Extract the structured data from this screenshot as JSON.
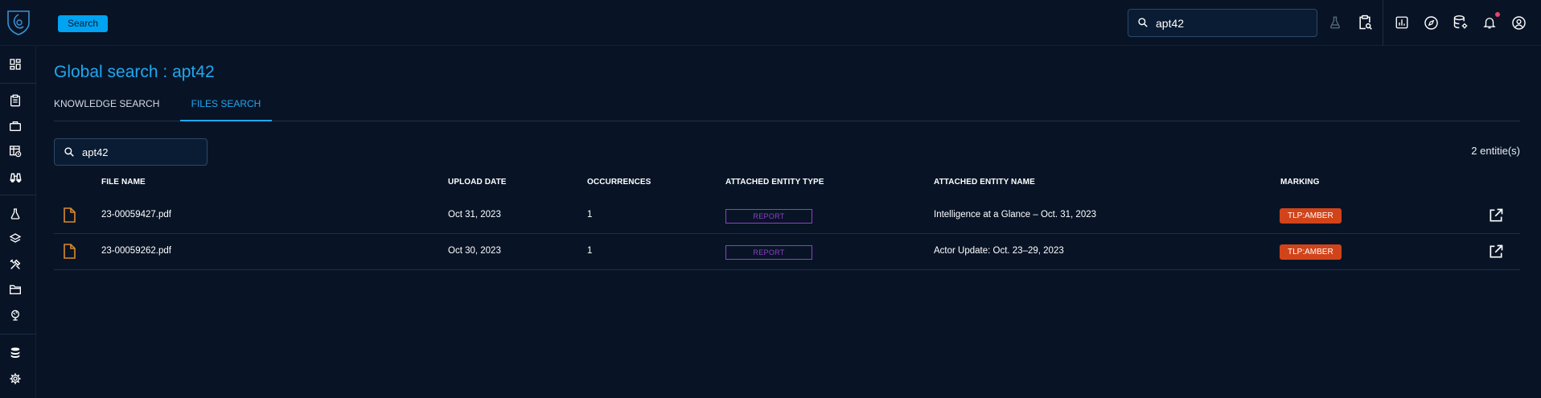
{
  "colors": {
    "background": "#081426",
    "accent": "#1fa8f0",
    "badge": "#00a3f2",
    "marking": "#d1441a",
    "entity_type": "#8e3fc8",
    "file_icon": "#d98a2b",
    "notification_dot": "#e9446a"
  },
  "topbar": {
    "badge_label": "Search",
    "search_value": "apt42",
    "icons": [
      "flask-icon",
      "clipboard-search-icon",
      "chart-icon",
      "compass-icon",
      "database-gear-icon",
      "bell-icon",
      "account-icon"
    ]
  },
  "leftnav": {
    "icons": [
      "dashboard-icon",
      "clipboard-icon",
      "briefcase-icon",
      "table-clock-icon",
      "binoculars-icon",
      "flask-icon",
      "layers-icon",
      "tools-icon",
      "folder-icon",
      "globe-icon",
      "database-icon",
      "gear-icon"
    ]
  },
  "page": {
    "title": "Global search : apt42",
    "tabs": {
      "knowledge": "KNOWLEDGE SEARCH",
      "files": "FILES SEARCH"
    },
    "search_value": "apt42",
    "entity_count": "2 entitie(s)"
  },
  "table": {
    "headers": {
      "file_name": "FILE NAME",
      "upload_date": "UPLOAD DATE",
      "occurrences": "OCCURRENCES",
      "entity_type": "ATTACHED ENTITY TYPE",
      "entity_name": "ATTACHED ENTITY NAME",
      "marking": "MARKING"
    },
    "rows": [
      {
        "file_name": "23-00059427.pdf",
        "upload_date": "Oct 31, 2023",
        "occurrences": "1",
        "entity_type": "REPORT",
        "entity_name": "Intelligence at a Glance – Oct. 31, 2023",
        "marking": "TLP:AMBER"
      },
      {
        "file_name": "23-00059262.pdf",
        "upload_date": "Oct 30, 2023",
        "occurrences": "1",
        "entity_type": "REPORT",
        "entity_name": "Actor Update: Oct. 23–29, 2023",
        "marking": "TLP:AMBER"
      }
    ]
  }
}
